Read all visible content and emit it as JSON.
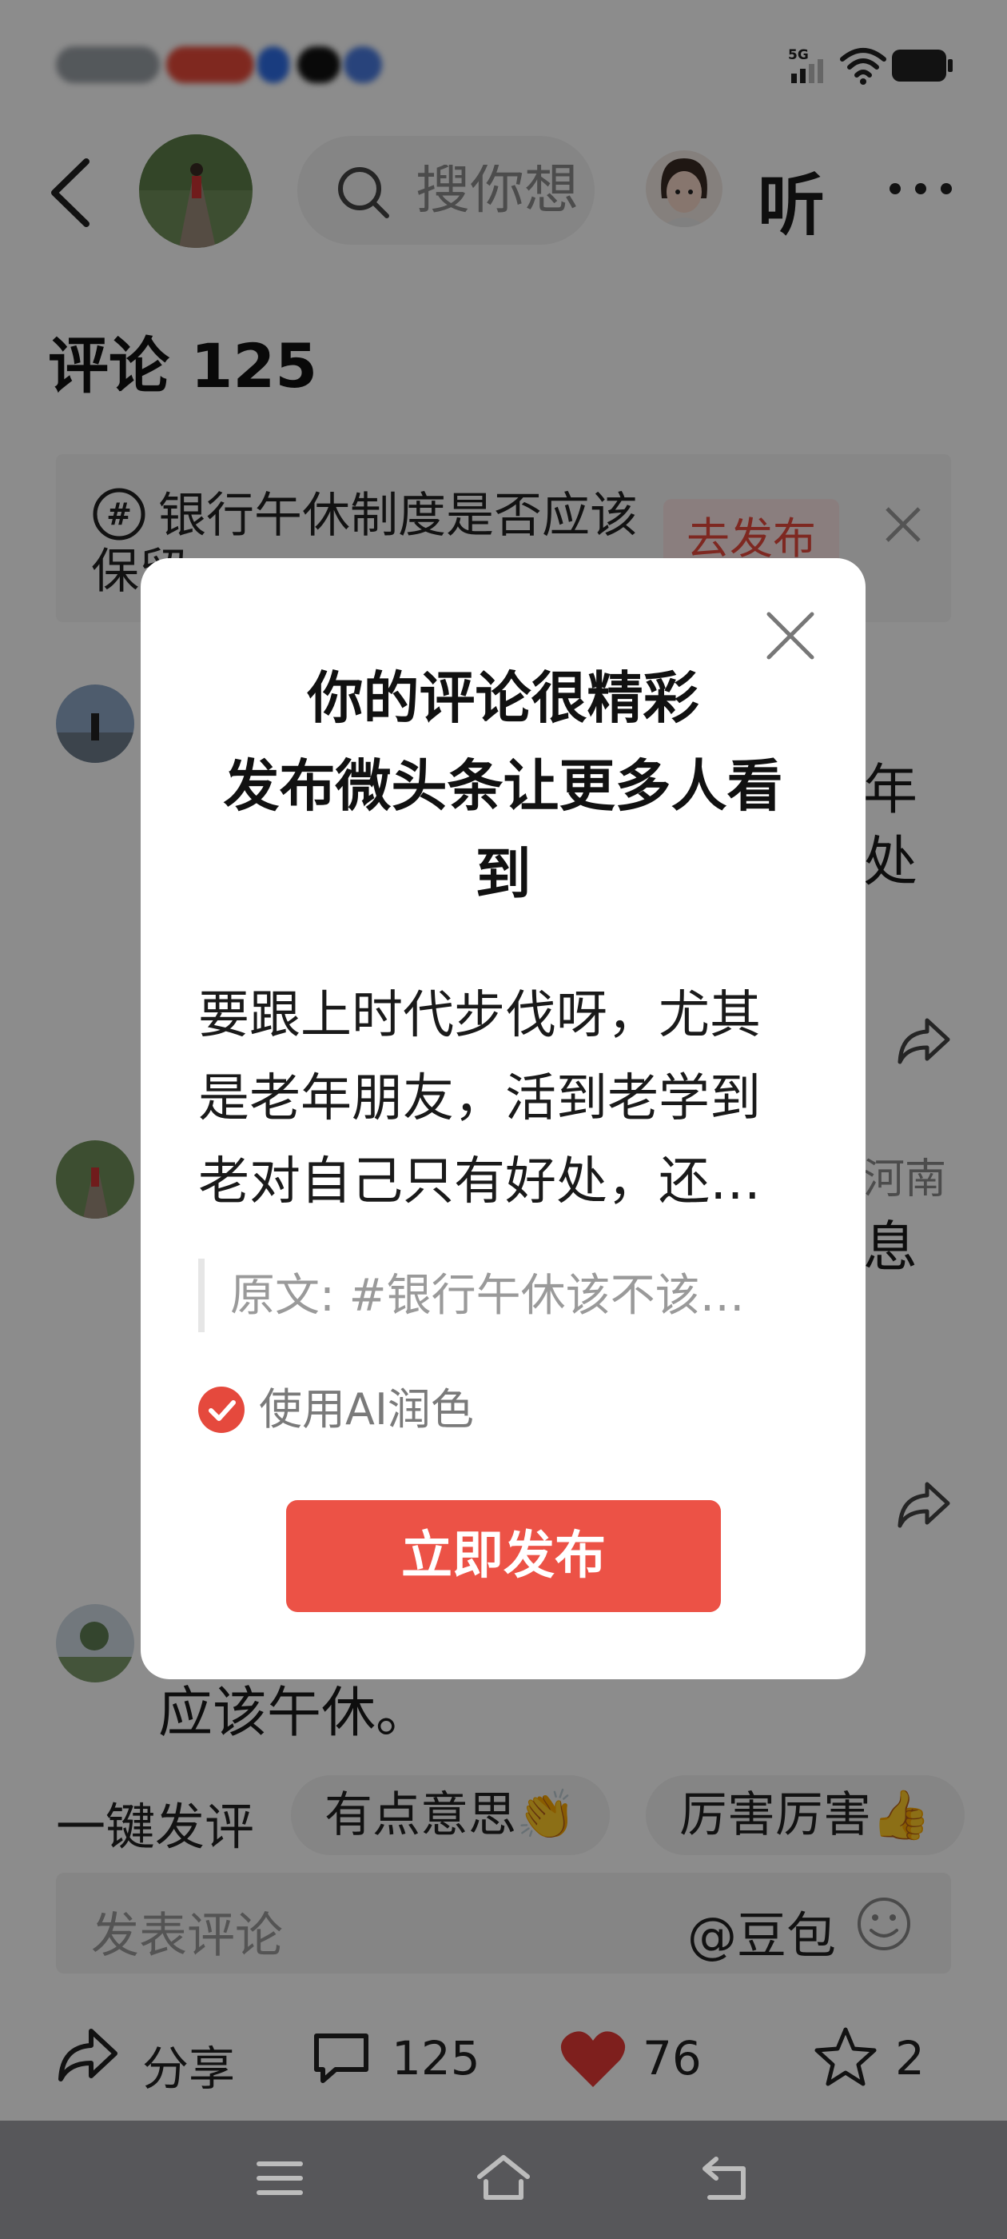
{
  "status_bar": {
    "network": "5G"
  },
  "header": {
    "search_placeholder": "搜你想",
    "listen_label": "听"
  },
  "comments": {
    "title": "评论 125",
    "topic_banner": {
      "text": "银行午休制度是否应该保留",
      "button": "去发布"
    },
    "item1_right_fragment": [
      "年",
      "处"
    ],
    "item2_location_fragment": "河南",
    "item2_text_fragment": "息",
    "item3_text": "应该午休。"
  },
  "quick_reply": {
    "label": "一键发评",
    "chips": [
      "有点意思👏",
      "厉害厉害👍"
    ]
  },
  "comment_input": {
    "placeholder": "发表评论",
    "ai_mention": "@豆包"
  },
  "action_bar": {
    "share": "分享",
    "comments": "125",
    "likes": "76",
    "favorites": "2"
  },
  "dialog": {
    "title_line1": "你的评论很精彩",
    "title_line2": "发布微头条让更多人看到",
    "body": "要跟上时代步伐呀，尤其是老年朋友，活到老学到老对自己只有好处，还…",
    "quote": "原文: #银行午休该不该…",
    "ai_option": "使用AI润色",
    "publish_button": "立即发布"
  },
  "colors": {
    "accent": "#ec5246",
    "like": "#e53935"
  }
}
